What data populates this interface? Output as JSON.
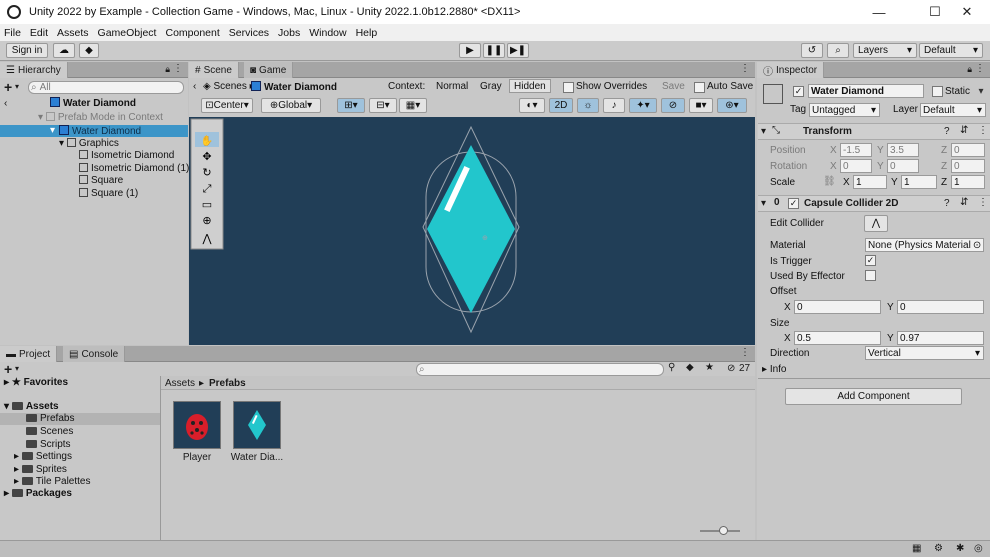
{
  "window": {
    "title": "Unity 2022 by Example - Collection Game - Windows, Mac, Linux - Unity 2022.1.0b12.2880* <DX11>",
    "minimize": "—",
    "maximize": "☐",
    "close": "✕"
  },
  "menu": [
    "File",
    "Edit",
    "Assets",
    "GameObject",
    "Component",
    "Services",
    "Jobs",
    "Window",
    "Help"
  ],
  "toolbar": {
    "sign_in": "Sign in",
    "layers": "Layers",
    "layout": "Default"
  },
  "hierarchy": {
    "tab": "Hierarchy",
    "search_placeholder": "All",
    "root": "Water Diamond",
    "context_line": "Prefab Mode in Context",
    "selected": "Water Diamond",
    "items": [
      {
        "label": "Graphics"
      },
      {
        "label": "Isometric Diamond"
      },
      {
        "label": "Isometric Diamond (1)"
      },
      {
        "label": "Square"
      },
      {
        "label": "Square (1)"
      }
    ]
  },
  "scene": {
    "tab_scene": "Scene",
    "tab_game": "Game",
    "breadcrumb_scenes": "Scenes",
    "breadcrumb_prefab": "Water Diamond",
    "context_label": "Context:",
    "context_normal": "Normal",
    "context_gray": "Gray",
    "context_hidden": "Hidden",
    "show_overrides": "Show Overrides",
    "save": "Save",
    "auto_save": "Auto Save",
    "pivot": "Center",
    "space": "Global",
    "colors": {
      "background": "#213e57",
      "diamond": "#22c6cc"
    }
  },
  "inspector": {
    "tab": "Inspector",
    "object_name": "Water Diamond",
    "static_label": "Static",
    "tag_label": "Tag",
    "tag_value": "Untagged",
    "layer_label": "Layer",
    "layer_value": "Default",
    "transform": {
      "title": "Transform",
      "position_label": "Position",
      "rotation_label": "Rotation",
      "scale_label": "Scale",
      "position": {
        "x": "-1.5",
        "y": "3.5",
        "z": "0"
      },
      "rotation": {
        "x": "0",
        "y": "0",
        "z": "0"
      },
      "scale": {
        "x": "1",
        "y": "1",
        "z": "1"
      }
    },
    "collider": {
      "title": "Capsule Collider 2D",
      "edit_collider": "Edit Collider",
      "material_label": "Material",
      "material_value": "None (Physics Material",
      "is_trigger": "Is Trigger",
      "used_by_effector": "Used By Effector",
      "offset_label": "Offset",
      "offset": {
        "x": "0",
        "y": "0"
      },
      "size_label": "Size",
      "size": {
        "x": "0.5",
        "y": "0.97"
      },
      "direction_label": "Direction",
      "direction_value": "Vertical",
      "info": "Info"
    },
    "add_component": "Add Component"
  },
  "project": {
    "tab_project": "Project",
    "tab_console": "Console",
    "hidden_count": "27",
    "favorites": "Favorites",
    "assets": "Assets",
    "folders": [
      "Prefabs",
      "Scenes",
      "Scripts",
      "Settings",
      "Sprites",
      "Tile Palettes"
    ],
    "packages": "Packages",
    "breadcrumb_root": "Assets",
    "breadcrumb_sep": "▸",
    "breadcrumb_leaf": "Prefabs",
    "prefab_items": [
      {
        "label": "Player"
      },
      {
        "label": "Water Dia..."
      }
    ]
  }
}
